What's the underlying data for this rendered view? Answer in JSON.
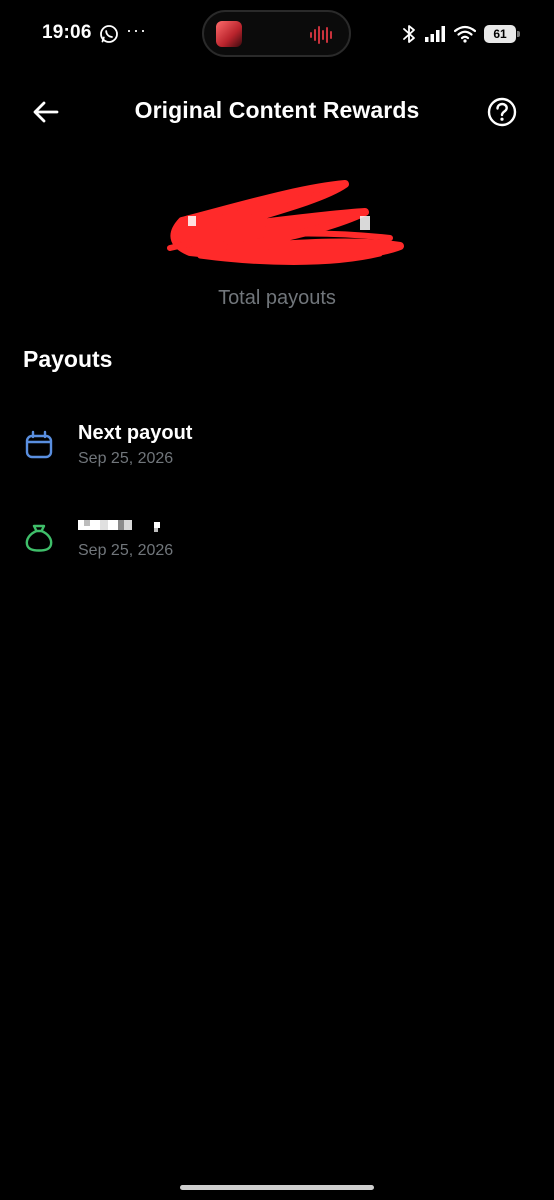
{
  "status_bar": {
    "time": "19:06",
    "more": "···",
    "battery": "61"
  },
  "header": {
    "title": "Original Content Rewards"
  },
  "total": {
    "label": "Total payouts"
  },
  "payouts": {
    "section_title": "Payouts",
    "items": [
      {
        "title": "Next payout",
        "date": "Sep 25, 2026",
        "icon": "calendar-icon",
        "icon_color": "#5a8fe0"
      },
      {
        "date": "Sep 25, 2026",
        "icon": "money-bag-icon",
        "icon_color": "#3fbf6a"
      }
    ]
  },
  "colors": {
    "background": "#000000",
    "text_primary": "#ffffff",
    "text_secondary": "#71767b",
    "redaction": "#ff2a2a"
  }
}
